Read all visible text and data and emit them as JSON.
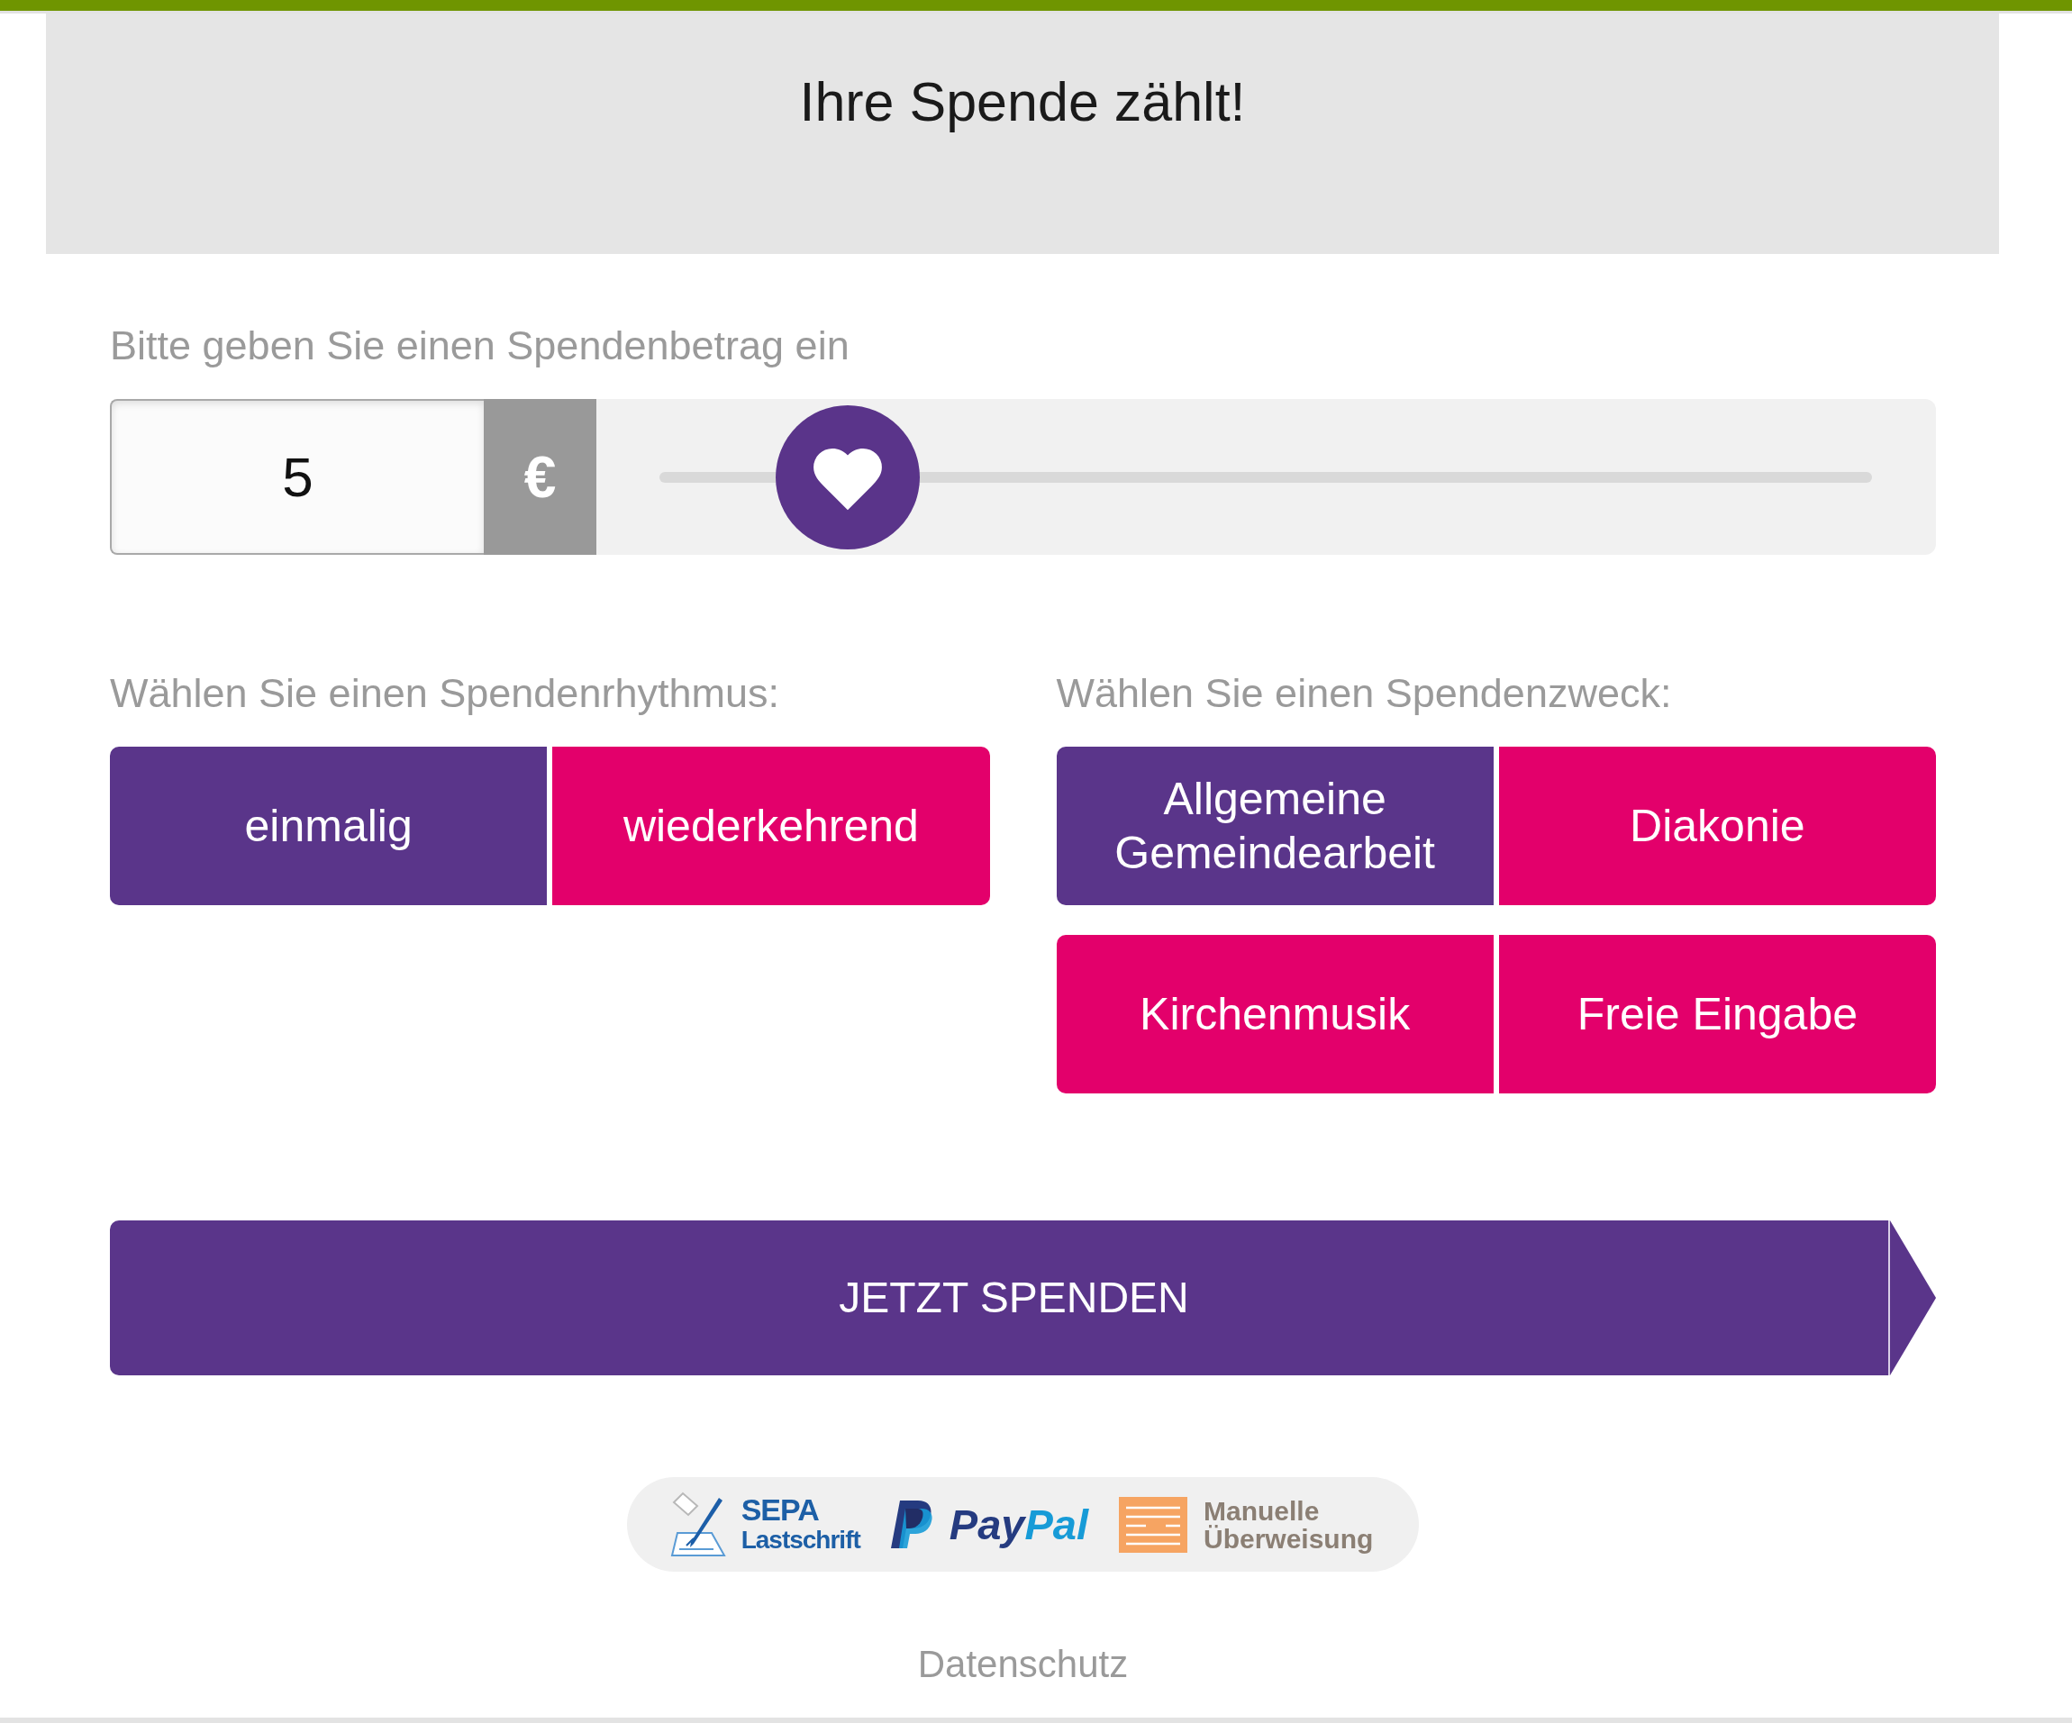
{
  "header": {
    "title": "Ihre Spende zählt!"
  },
  "amount": {
    "label": "Bitte geben Sie einen Spendenbetrag ein",
    "value": "5",
    "currency": "€",
    "level": 0.155
  },
  "rhythm": {
    "label": "Wählen Sie einen Spendenrhythmus:",
    "options": [
      {
        "label": "einmalig",
        "selected": true
      },
      {
        "label": "wiederkehrend",
        "selected": false
      }
    ]
  },
  "purpose": {
    "label": "Wählen Sie einen Spendenzweck:",
    "options": [
      {
        "label": "Allgemeine Gemeindearbeit",
        "selected": true
      },
      {
        "label": "Diakonie",
        "selected": false
      },
      {
        "label": "Kirchenmusik",
        "selected": false
      },
      {
        "label": "Freie Eingabe",
        "selected": false
      }
    ]
  },
  "submit_button": {
    "label": "JETZT SPENDEN"
  },
  "payment_methods": [
    {
      "kind": "sepa",
      "lines": [
        "SEPA",
        "Lastschrift"
      ]
    },
    {
      "kind": "paypal",
      "parts": [
        "Pay",
        "Pal"
      ]
    },
    {
      "kind": "transfer",
      "lines": [
        "Manuelle",
        "Überweisung"
      ]
    }
  ],
  "footer": {
    "link": "Datenschutz"
  }
}
